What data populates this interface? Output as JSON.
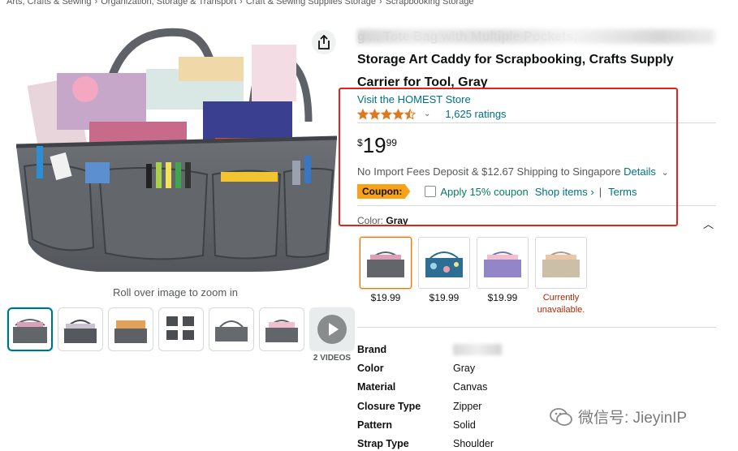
{
  "breadcrumb": {
    "items": [
      "Arts, Crafts & Sewing",
      "Organization, Storage & Transport",
      "Craft & Sewing Supplies Storage",
      "Scrapbooking Storage"
    ],
    "separator": "›"
  },
  "gallery": {
    "zoom_hint": "Roll over image to zoom in",
    "video_label": "2 VIDEOS",
    "thumbnails": [
      "gray-caddy-front",
      "caddy-open-top",
      "caddy-filled-side",
      "caddy-size-chart",
      "caddy-empty-gray",
      "caddy-filled-front",
      "caddy-brand-logo"
    ]
  },
  "product": {
    "title_line_1": "g ... Tote Bag with Multiple Pockets,",
    "title_line_2": "Storage Art Caddy for Scrapbooking, Crafts Supply",
    "title_line_3": "Carrier for Tool, Gray",
    "store_link": "Visit the HOMEST Store",
    "rating_stars": 4.5,
    "ratings_count": "1,625 ratings",
    "price_symbol": "$",
    "price_whole": "19",
    "price_fraction": "99",
    "shipping_text": "No Import Fees Deposit & $12.67 Shipping to Singapore",
    "shipping_details": "Details",
    "coupon_badge": "Coupon:",
    "coupon_text": "Apply 15% coupon",
    "shop_items": "Shop items ›",
    "bar": "|",
    "terms": "Terms",
    "color_label": "Color:",
    "color_value": "Gray"
  },
  "swatches": [
    {
      "name": "gray",
      "price": "$19.99",
      "selected": true
    },
    {
      "name": "floral-blue",
      "price": "$19.99",
      "selected": false
    },
    {
      "name": "purple",
      "price": "$19.99",
      "selected": false
    },
    {
      "name": "khaki",
      "price": "",
      "unavailable": "Currently unavailable.",
      "selected": false
    }
  ],
  "specs": [
    {
      "key": "Brand",
      "value": ""
    },
    {
      "key": "Color",
      "value": "Gray"
    },
    {
      "key": "Material",
      "value": "Canvas"
    },
    {
      "key": "Closure Type",
      "value": "Zipper"
    },
    {
      "key": "Pattern",
      "value": "Solid"
    },
    {
      "key": "Strap Type",
      "value": "Shoulder"
    }
  ],
  "watermark": "微信号: JieyinIP",
  "colors": {
    "link": "#007185",
    "coupon_badge": "#f7a21a",
    "coupon_text": "#067d62",
    "annotation_box": "#e2231a",
    "unavailable": "#b12704",
    "star": "#de7921"
  }
}
